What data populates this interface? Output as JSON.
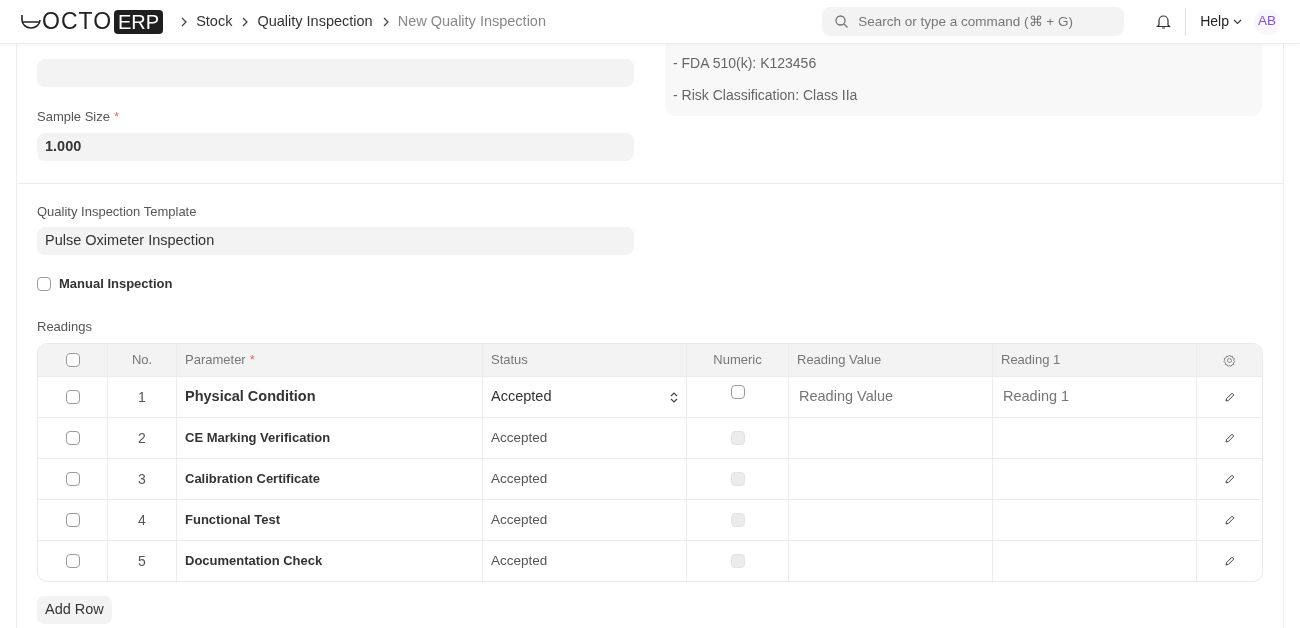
{
  "navbar": {
    "logo_text": "OCTO",
    "logo_badge": "ERP",
    "breadcrumbs": [
      {
        "label": "Stock",
        "current": false
      },
      {
        "label": "Quality Inspection",
        "current": false
      },
      {
        "label": "New Quality Inspection",
        "current": true
      }
    ],
    "search": {
      "placeholder": "Search or type a command (⌘ + G)"
    },
    "help": "Help",
    "avatar": "AB"
  },
  "details": {
    "lines": [
      "- FDA 510(k): K123456",
      "- Risk Classification: Class IIa"
    ]
  },
  "sample_size": {
    "label": "Sample Size",
    "required_mark": "*",
    "value": "1.000"
  },
  "template": {
    "label": "Quality Inspection Template",
    "value": "Pulse Oximeter Inspection"
  },
  "manual_inspection": {
    "label": "Manual Inspection",
    "checked": false
  },
  "readings": {
    "label": "Readings",
    "all_selected": false,
    "columns": [
      {
        "label": "No."
      },
      {
        "label": "Parameter",
        "required_mark": "*"
      },
      {
        "label": "Status"
      },
      {
        "label": "Numeric"
      },
      {
        "label": "Reading Value"
      },
      {
        "label": "Reading 1"
      }
    ],
    "rows": [
      {
        "no": "1",
        "parameter": "Physical Condition",
        "status": "Accepted",
        "numeric": false,
        "editing": true,
        "selected": false,
        "reading_value_placeholder": "Reading Value",
        "reading_1_placeholder": "Reading 1"
      },
      {
        "no": "2",
        "parameter": "CE Marking Verification",
        "status": "Accepted",
        "numeric": false,
        "editing": false,
        "selected": false
      },
      {
        "no": "3",
        "parameter": "Calibration Certificate",
        "status": "Accepted",
        "numeric": false,
        "editing": false,
        "selected": false
      },
      {
        "no": "4",
        "parameter": "Functional Test",
        "status": "Accepted",
        "numeric": false,
        "editing": false,
        "selected": false
      },
      {
        "no": "5",
        "parameter": "Documentation Check",
        "status": "Accepted",
        "numeric": false,
        "editing": false,
        "selected": false
      }
    ],
    "add_row": "Add Row"
  }
}
